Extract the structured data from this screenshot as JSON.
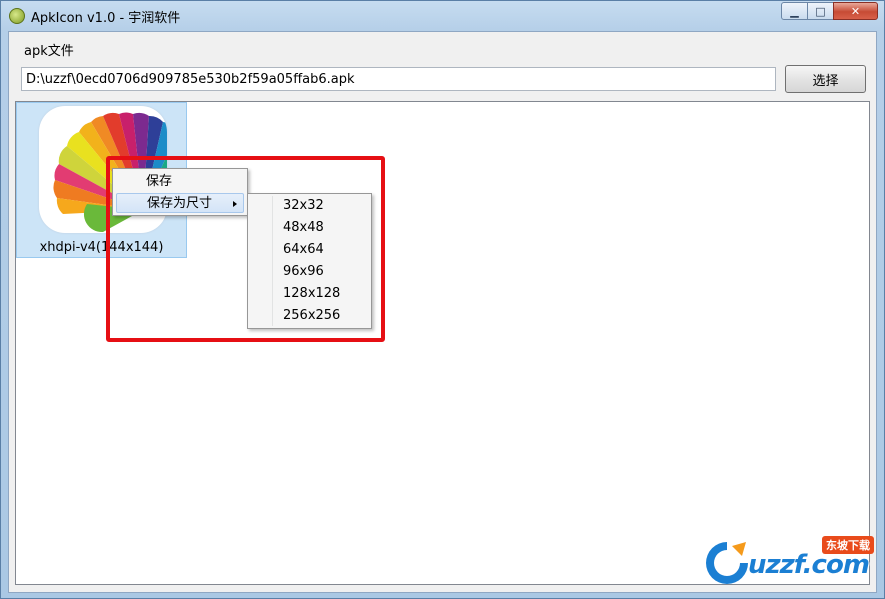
{
  "window": {
    "title": "ApkIcon v1.0 - 宇润软件",
    "minimize_glyph": "▁",
    "maximize_glyph": "□",
    "close_glyph": "✕"
  },
  "apk_group": {
    "label": "apk文件",
    "path_value": "D:\\uzzf\\0ecd0706d909785e530b2f59a05ffab6.apk",
    "choose_label": "选择"
  },
  "icons": [
    {
      "label": "xhdpi-v4(144x144)",
      "icon": "colorful-fan-app-icon"
    }
  ],
  "context_menu": {
    "items": [
      {
        "label": "保存"
      },
      {
        "label": "保存为尺寸"
      }
    ]
  },
  "size_submenu": {
    "items": [
      "32x32",
      "48x48",
      "64x64",
      "96x96",
      "128x128",
      "256x256"
    ]
  },
  "watermark": {
    "text": "uzzf.com",
    "badge": "东坡下载"
  },
  "colors": {
    "highlight_box": "#e60f14",
    "selection": "#cce4f7",
    "watermark_blue": "#1b7fd3",
    "watermark_orange": "#e94b1b"
  }
}
